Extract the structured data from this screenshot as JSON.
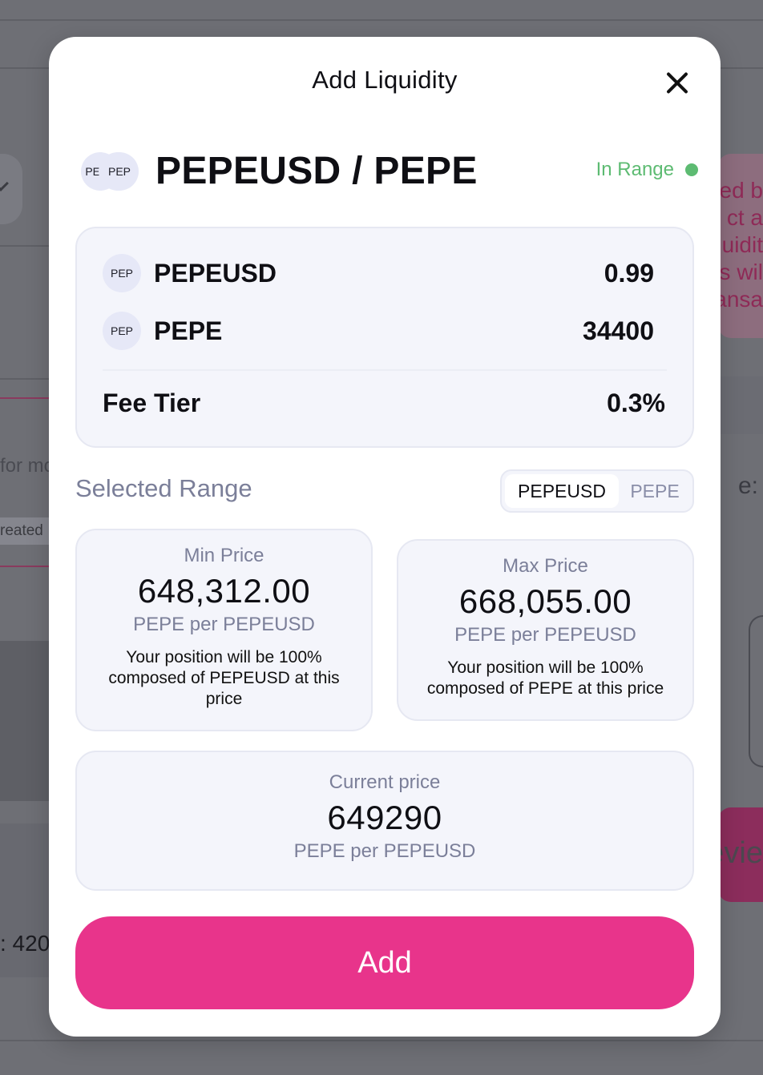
{
  "background": {
    "left_text": "for mo",
    "left_tag": "reated",
    "left_bottom_text": ": 420",
    "right_warning_lines": [
      "ed b",
      "ct a",
      "uidit",
      "s wil",
      "ansa"
    ],
    "right_label_fragment": "e:",
    "right_button_fragment": "evie"
  },
  "modal": {
    "title": "Add Liquidity",
    "close_icon": "close-icon",
    "pair": {
      "name": "PEPEUSD / PEPE",
      "logo_a": "PEPE",
      "logo_b": "PEP",
      "status": "In Range",
      "status_color": "#5dbb72"
    },
    "tokens": [
      {
        "logo": "PEP",
        "name": "PEPEUSD",
        "amount": "0.99"
      },
      {
        "logo": "PEP",
        "name": "PEPE",
        "amount": "34400"
      }
    ],
    "fee": {
      "label": "Fee Tier",
      "value": "0.3%"
    },
    "range": {
      "label": "Selected Range",
      "toggle": {
        "active": "PEPEUSD",
        "inactive": "PEPE"
      },
      "min": {
        "caption": "Min Price",
        "value": "648,312.00",
        "unit": "PEPE per PEPEUSD",
        "note": "Your position will be 100% composed of PEPEUSD at this price"
      },
      "max": {
        "caption": "Max Price",
        "value": "668,055.00",
        "unit": "PEPE per PEPEUSD",
        "note": "Your position will be 100% composed of PEPE at this price"
      },
      "current": {
        "caption": "Current price",
        "value": "649290",
        "unit": "PEPE per PEPEUSD"
      }
    },
    "add_button": "Add",
    "accent_color": "#e8348b"
  }
}
